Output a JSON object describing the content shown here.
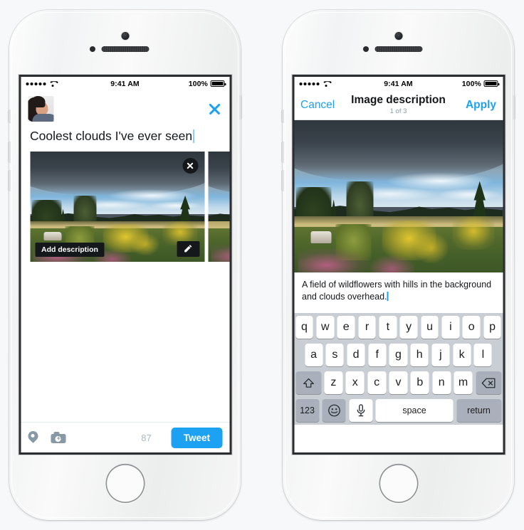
{
  "status_bar": {
    "signal_dots": 5,
    "wifi_icon": "wifi-icon",
    "time": "9:41 AM",
    "battery_percent": "100%",
    "battery_icon": "battery-full-icon"
  },
  "left_phone": {
    "screen_name": "compose-tweet-screen",
    "avatar_icon": "user-avatar",
    "close_icon": "close-x-icon",
    "tweet_text": "Coolest clouds I've ever seen",
    "photo": {
      "remove_icon": "remove-photo-icon",
      "add_description_label": "Add description",
      "edit_icon": "pencil-icon",
      "alt_subject": "field of wildflowers with hills and storm clouds"
    },
    "toolbar": {
      "location_icon": "location-pin-icon",
      "camera_icon": "camera-add-icon",
      "char_counter": "87",
      "tweet_button": "Tweet"
    }
  },
  "right_phone": {
    "screen_name": "image-description-screen",
    "navbar": {
      "cancel_label": "Cancel",
      "title": "Image description",
      "subtitle": "1 of 3",
      "apply_label": "Apply"
    },
    "description_value": "A field of wildflowers with hills in the background and clouds overhead.",
    "keyboard": {
      "row1": [
        "q",
        "w",
        "e",
        "r",
        "t",
        "y",
        "u",
        "i",
        "o",
        "p"
      ],
      "row2": [
        "a",
        "s",
        "d",
        "f",
        "g",
        "h",
        "j",
        "k",
        "l"
      ],
      "row3": [
        "z",
        "x",
        "c",
        "v",
        "b",
        "n",
        "m"
      ],
      "shift_icon": "shift-up-arrow-icon",
      "delete_icon": "backspace-delete-icon",
      "numbers_key": "123",
      "emoji_icon": "smiley-emoji-icon",
      "dictation_icon": "microphone-icon",
      "space_key": "space",
      "return_key": "return"
    }
  },
  "colors": {
    "accent_blue": "#1da1f2",
    "text_dark": "#14171a",
    "muted_gray": "#8899a6",
    "counter_gray": "#aab8c2",
    "keyboard_bg": "#c9ced4",
    "key_gray": "#a9b0bb",
    "overlay_black": "#15181b"
  }
}
